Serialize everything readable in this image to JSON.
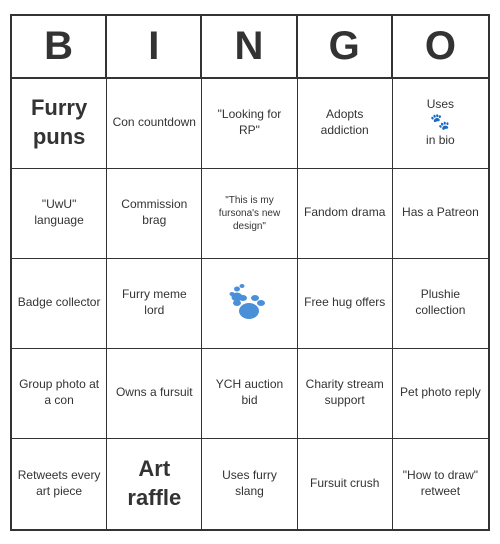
{
  "header": {
    "letters": [
      "B",
      "I",
      "N",
      "G",
      "O"
    ]
  },
  "cells": [
    {
      "id": "furry-puns",
      "text": "Furry puns",
      "size": "xl"
    },
    {
      "id": "con-countdown",
      "text": "Con countdown",
      "size": "normal"
    },
    {
      "id": "looking-for-rp",
      "text": "\"Looking for RP\"",
      "size": "normal"
    },
    {
      "id": "adopts-addiction",
      "text": "Adopts addiction",
      "size": "normal"
    },
    {
      "id": "uses-in-bio",
      "text": "Uses 🐾 in bio",
      "size": "normal",
      "has_paw": true
    },
    {
      "id": "uwu-language",
      "text": "\"UwU\" language",
      "size": "normal"
    },
    {
      "id": "commission-brag",
      "text": "Commission brag",
      "size": "normal"
    },
    {
      "id": "fursona-design",
      "text": "\"This is my fursona's new design\"",
      "size": "small"
    },
    {
      "id": "fandom-drama",
      "text": "Fandom drama",
      "size": "normal"
    },
    {
      "id": "has-patreon",
      "text": "Has a Patreon",
      "size": "normal"
    },
    {
      "id": "badge-collector",
      "text": "Badge collector",
      "size": "normal"
    },
    {
      "id": "meme-lord",
      "text": "Furry meme lord",
      "size": "normal"
    },
    {
      "id": "free-space",
      "text": "",
      "size": "free",
      "is_free": true
    },
    {
      "id": "free-hug",
      "text": "Free hug offers",
      "size": "normal"
    },
    {
      "id": "plushie-collection",
      "text": "Plushie collection",
      "size": "normal"
    },
    {
      "id": "group-photo",
      "text": "Group photo at a con",
      "size": "normal"
    },
    {
      "id": "owns-fursuit",
      "text": "Owns a fursuit",
      "size": "normal"
    },
    {
      "id": "ych-auction",
      "text": "YCH auction bid",
      "size": "normal"
    },
    {
      "id": "charity-stream",
      "text": "Charity stream support",
      "size": "normal"
    },
    {
      "id": "pet-photo-reply",
      "text": "Pet photo reply",
      "size": "normal"
    },
    {
      "id": "retweets-art",
      "text": "Retweets every art piece",
      "size": "normal"
    },
    {
      "id": "art-raffle",
      "text": "Art raffle",
      "size": "xl"
    },
    {
      "id": "furry-slang",
      "text": "Uses furry slang",
      "size": "normal"
    },
    {
      "id": "fursuit-crush",
      "text": "Fursuit crush",
      "size": "normal"
    },
    {
      "id": "how-to-draw",
      "text": "\"How to draw\" retweet",
      "size": "normal"
    }
  ]
}
